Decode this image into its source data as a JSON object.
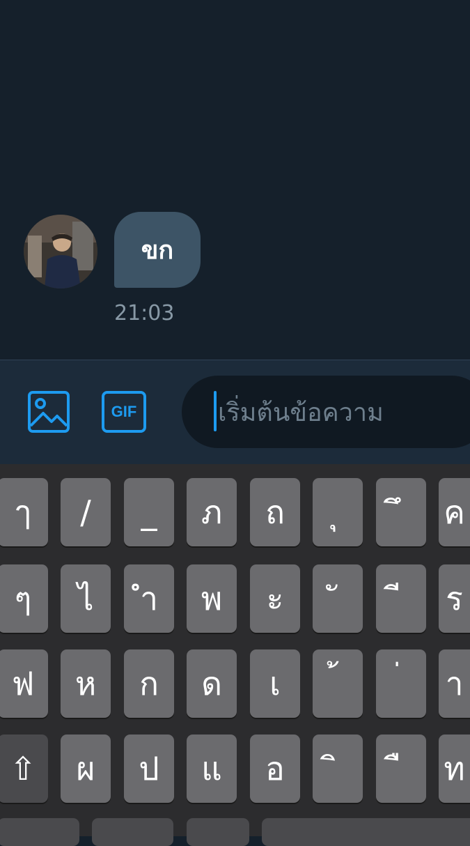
{
  "conversation": {
    "message": {
      "text": "ขก",
      "time": "21:03"
    }
  },
  "composer": {
    "media_icon": "image-icon",
    "gif_label": "GIF",
    "input_placeholder": "เริ่มต้นข้อความ"
  },
  "keyboard": {
    "rows": [
      [
        "ๅ",
        "/",
        "_",
        "ภ",
        "ถ",
        "ุ",
        "ึ",
        "ค"
      ],
      [
        "ๆ",
        "ไ",
        "ำ",
        "พ",
        "ะ",
        "ั",
        "ี",
        "ร"
      ],
      [
        "ฟ",
        "ห",
        "ก",
        "ด",
        "เ",
        "้",
        "่",
        "า"
      ],
      [
        "⇧",
        "ผ",
        "ป",
        "แ",
        "อ",
        "ิ",
        "ื",
        "ท"
      ]
    ]
  },
  "colors": {
    "background": "#15202b",
    "accent": "#1d9bf0",
    "bubble": "#3d5466",
    "key": "#6b6b6e"
  }
}
